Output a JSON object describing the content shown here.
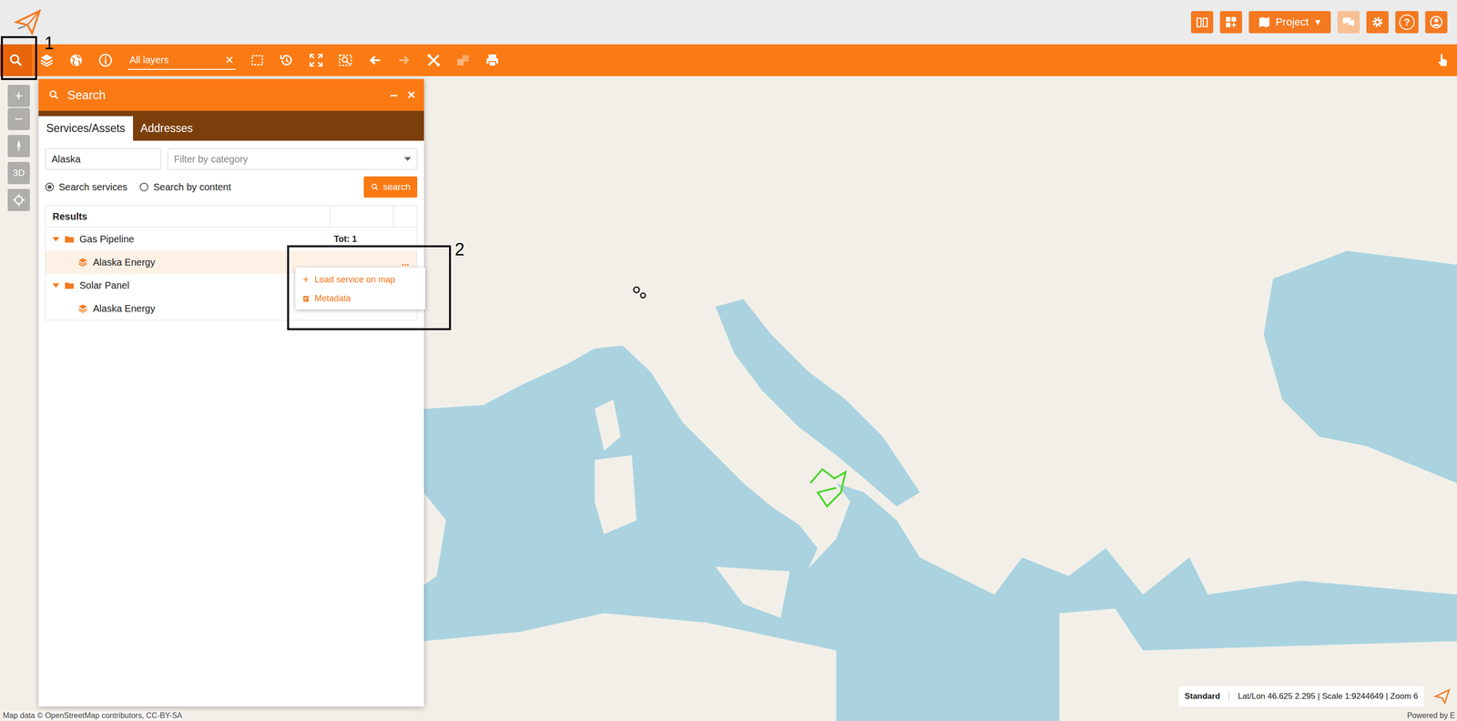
{
  "annotations": [
    {
      "label": "1"
    },
    {
      "label": "2"
    }
  ],
  "header": {
    "project_button": {
      "label": "Project",
      "caret": "▼"
    },
    "chat": {
      "disabled": true
    },
    "help_glyph": "?"
  },
  "toolbar": {
    "search_button": {
      "active": true
    },
    "layer_filter": {
      "value": "All layers",
      "clear": "×"
    },
    "tools": [
      {
        "disabled": false
      },
      {
        "disabled": false
      },
      {
        "disabled": false
      },
      {
        "disabled": false
      },
      {
        "disabled": false
      },
      {
        "disabled": true
      },
      {
        "disabled": false
      },
      {
        "disabled": true
      },
      {
        "disabled": false
      }
    ]
  },
  "map_controls": {
    "zoom_in": "+",
    "zoom_out": "−",
    "view_3d": "3D"
  },
  "search_panel": {
    "title": "Search",
    "minimize": "–",
    "close": "×",
    "tabs": [
      {
        "label": "Services/Assets",
        "selected": true
      },
      {
        "label": "Addresses",
        "selected": false
      }
    ],
    "query": "Alaska",
    "category_placeholder": "Filter by category",
    "modes": [
      {
        "label": "Search services",
        "selected": true
      },
      {
        "label": "Search by content",
        "selected": false
      }
    ],
    "search_button": "search",
    "results": {
      "column": "Results",
      "groups": [
        {
          "name": "Gas Pipeline",
          "expanded": true,
          "total": "Tot: 1",
          "items": [
            {
              "name": "Alaska Energy",
              "selected": true,
              "menu": "..."
            }
          ]
        },
        {
          "name": "Solar Panel",
          "expanded": true,
          "total": "",
          "items": [
            {
              "name": "Alaska Energy",
              "selected": false,
              "menu": ""
            }
          ]
        }
      ]
    },
    "context_menu": [
      {
        "glyph": "+",
        "label": "Load service on map"
      },
      {
        "glyph": "",
        "label": "Metadata"
      }
    ]
  },
  "status_bar": {
    "style": "Standard",
    "coords": "Lat/Lon 46.625 2.295 | Scale 1:9244649 | Zoom 6"
  },
  "attribution": "Map data © OpenStreetMap contributors, CC-BY-SA",
  "powered_by": "Powered by E"
}
